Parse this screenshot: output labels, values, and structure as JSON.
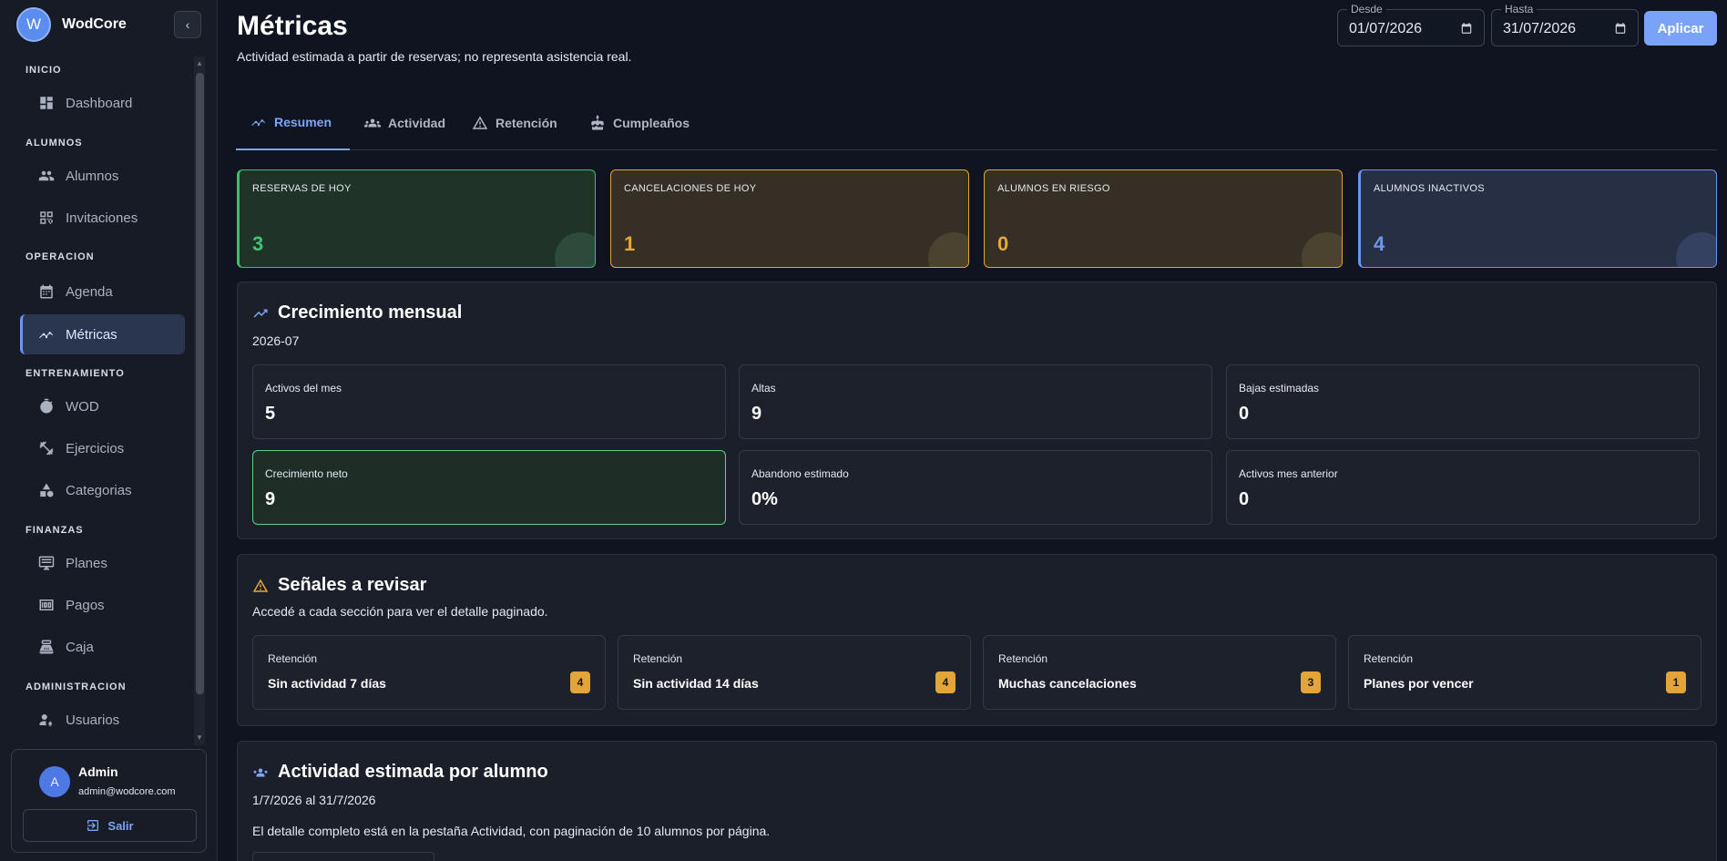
{
  "brand": {
    "initial": "W",
    "name": "WodCore"
  },
  "sidebar": {
    "sections": [
      {
        "title": "INICIO",
        "items": [
          {
            "label": "Dashboard",
            "icon": "dashboard-icon"
          }
        ]
      },
      {
        "title": "ALUMNOS",
        "items": [
          {
            "label": "Alumnos",
            "icon": "people-icon"
          },
          {
            "label": "Invitaciones",
            "icon": "qr-icon"
          }
        ]
      },
      {
        "title": "OPERACION",
        "items": [
          {
            "label": "Agenda",
            "icon": "calendar-icon"
          },
          {
            "label": "Métricas",
            "icon": "metrics-icon"
          }
        ]
      },
      {
        "title": "ENTRENAMIENTO",
        "items": [
          {
            "label": "WOD",
            "icon": "timer-icon"
          },
          {
            "label": "Ejercicios",
            "icon": "dumbbell-icon"
          },
          {
            "label": "Categorias",
            "icon": "shapes-icon"
          }
        ]
      },
      {
        "title": "FINANZAS",
        "items": [
          {
            "label": "Planes",
            "icon": "monitor-icon"
          },
          {
            "label": "Pagos",
            "icon": "money-icon"
          },
          {
            "label": "Caja",
            "icon": "register-icon"
          }
        ]
      },
      {
        "title": "ADMINISTRACION",
        "items": [
          {
            "label": "Usuarios",
            "icon": "user-gear-icon"
          }
        ]
      }
    ],
    "active_item": "Métricas"
  },
  "user": {
    "initial": "A",
    "name": "Admin",
    "email": "admin@wodcore.com",
    "logout_label": "Salir"
  },
  "header": {
    "title": "Métricas",
    "subtitle": "Actividad estimada a partir de reservas; no representa asistencia real.",
    "from_label": "Desde",
    "from_value": "01/07/2026",
    "to_label": "Hasta",
    "to_value": "31/07/2026",
    "apply_label": "Aplicar"
  },
  "tabs": [
    {
      "label": "Resumen",
      "icon": "trend-icon",
      "active": true
    },
    {
      "label": "Actividad",
      "icon": "group-icon",
      "active": false
    },
    {
      "label": "Retención",
      "icon": "warning-icon",
      "active": false
    },
    {
      "label": "Cumpleaños",
      "icon": "cake-icon",
      "active": false
    }
  ],
  "kpis": [
    {
      "label": "RESERVAS DE HOY",
      "value": "3",
      "color": "#3fc56f"
    },
    {
      "label": "CANCELACIONES DE HOY",
      "value": "1",
      "color": "#e6a836"
    },
    {
      "label": "ALUMNOS EN RIESGO",
      "value": "0",
      "color": "#e6a836"
    },
    {
      "label": "ALUMNOS INACTIVOS",
      "value": "4",
      "color": "#6d96f0"
    }
  ],
  "growth": {
    "title": "Crecimiento mensual",
    "period": "2026-07",
    "stats": [
      {
        "label": "Activos del mes",
        "value": "5"
      },
      {
        "label": "Altas",
        "value": "9"
      },
      {
        "label": "Bajas estimadas",
        "value": "0"
      },
      {
        "label": "Crecimiento neto",
        "value": "9"
      },
      {
        "label": "Abandono estimado",
        "value": "0%"
      },
      {
        "label": "Activos mes anterior",
        "value": "0"
      }
    ]
  },
  "signals": {
    "title": "Señales a revisar",
    "subtitle": "Accedé a cada sección para ver el detalle paginado.",
    "items": [
      {
        "category": "Retención",
        "name": "Sin actividad 7 días",
        "count": "4"
      },
      {
        "category": "Retención",
        "name": "Sin actividad 14 días",
        "count": "4"
      },
      {
        "category": "Retención",
        "name": "Muchas cancelaciones",
        "count": "3"
      },
      {
        "category": "Retención",
        "name": "Planes por vencer",
        "count": "1"
      }
    ]
  },
  "activity": {
    "title": "Actividad estimada por alumno",
    "range": "1/7/2026 al 31/7/2026",
    "note": "El detalle completo está en la pestaña Actividad, con paginación de 10 alumnos por página."
  },
  "colors": {
    "accent": "#7aa3f7",
    "success": "#3fc56f",
    "warning": "#e6a836",
    "info": "#6d96f0"
  }
}
